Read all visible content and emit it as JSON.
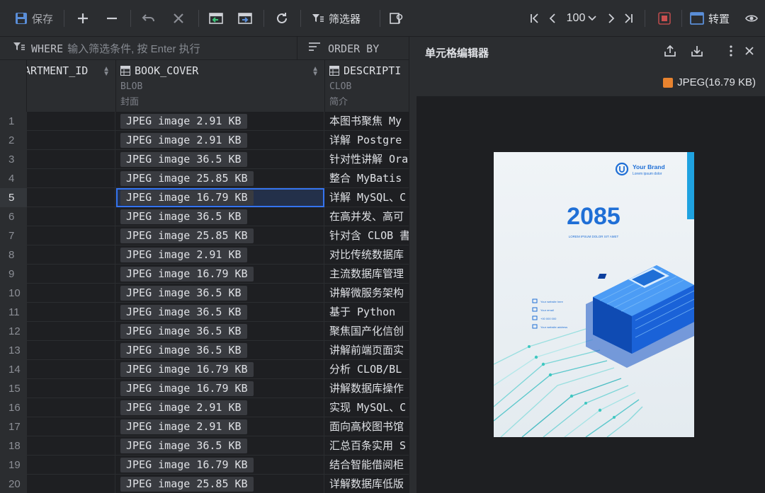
{
  "toolbar": {
    "save_label": "保存",
    "filter_label": "筛选器",
    "page_size": "100",
    "transpose_label": "转置"
  },
  "filter": {
    "where_keyword": "WHERE",
    "where_placeholder": "输入筛选条件, 按 Enter 执行",
    "order_keyword": "ORDER BY"
  },
  "columns": [
    {
      "name": "ARTMENT_ID",
      "type": "",
      "comment": ""
    },
    {
      "name": "BOOK_COVER",
      "type": "BLOB",
      "comment": "封面"
    },
    {
      "name": "DESCRIPTI",
      "type": "CLOB",
      "comment": "简介"
    }
  ],
  "rows": [
    {
      "num": "1",
      "cover": "JPEG image 2.91 KB",
      "desc": "本图书聚焦 My"
    },
    {
      "num": "2",
      "cover": "JPEG image 2.91 KB",
      "desc": "详解 Postgre"
    },
    {
      "num": "3",
      "cover": "JPEG image 36.5 KB",
      "desc": "针对性讲解 Ora"
    },
    {
      "num": "4",
      "cover": "JPEG image 25.85 KB",
      "desc": "整合 MyBatis"
    },
    {
      "num": "5",
      "cover": "JPEG image 16.79 KB",
      "desc": "详解 MySQL、C"
    },
    {
      "num": "6",
      "cover": "JPEG image 36.5 KB",
      "desc": "在高并发、高可"
    },
    {
      "num": "7",
      "cover": "JPEG image 25.85 KB",
      "desc": "针对含 CLOB 書"
    },
    {
      "num": "8",
      "cover": "JPEG image 2.91 KB",
      "desc": "对比传统数据库"
    },
    {
      "num": "9",
      "cover": "JPEG image 16.79 KB",
      "desc": "主流数据库管理"
    },
    {
      "num": "10",
      "cover": "JPEG image 36.5 KB",
      "desc": "讲解微服务架构"
    },
    {
      "num": "11",
      "cover": "JPEG image 36.5 KB",
      "desc": "基于 Python"
    },
    {
      "num": "12",
      "cover": "JPEG image 36.5 KB",
      "desc": "聚焦国产化信创"
    },
    {
      "num": "13",
      "cover": "JPEG image 36.5 KB",
      "desc": "讲解前端页面实"
    },
    {
      "num": "14",
      "cover": "JPEG image 16.79 KB",
      "desc": "分析 CLOB/BL"
    },
    {
      "num": "15",
      "cover": "JPEG image 16.79 KB",
      "desc": "讲解数据库操作"
    },
    {
      "num": "16",
      "cover": "JPEG image 2.91 KB",
      "desc": "实现 MySQL、C"
    },
    {
      "num": "17",
      "cover": "JPEG image 2.91 KB",
      "desc": "面向高校图书馆"
    },
    {
      "num": "18",
      "cover": "JPEG image 36.5 KB",
      "desc": "汇总百条实用 S"
    },
    {
      "num": "19",
      "cover": "JPEG image 16.79 KB",
      "desc": "结合智能借阅柜"
    },
    {
      "num": "20",
      "cover": "JPEG image 25.85 KB",
      "desc": "详解数据库低版"
    }
  ],
  "selected_row": 5,
  "panel": {
    "title": "单元格编辑器",
    "image_info": "JPEG(16.79 KB)"
  },
  "cover_image": {
    "brand": "Your Brand",
    "brand_sub": "Lorem ipsum dolor",
    "year": "2085",
    "tagline": "LOREM IPSUM DOLOR SIT AMET",
    "contacts": [
      "Your website here",
      "Your email",
      "+00 000 000",
      "Your website address"
    ]
  },
  "colors": {
    "accent": "#3574f0",
    "cover_blue": "#1f6fd6",
    "cover_teal": "#3ec7c0"
  }
}
